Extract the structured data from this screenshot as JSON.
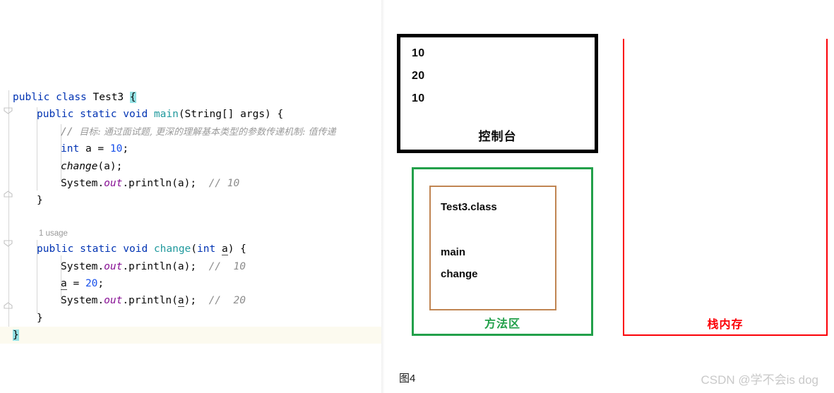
{
  "editor": {
    "usage_hint": "1 usage",
    "lines": [
      {
        "id": "line-class-decl",
        "indent": 0,
        "current": false
      },
      {
        "id": "line-main-sig",
        "indent": 1,
        "current": false
      },
      {
        "id": "line-comment",
        "indent": 2,
        "current": false
      },
      {
        "id": "line-int-a",
        "indent": 2,
        "current": false
      },
      {
        "id": "line-change-call",
        "indent": 2,
        "current": false
      },
      {
        "id": "line-println-main",
        "indent": 2,
        "current": false
      },
      {
        "id": "line-main-close",
        "indent": 1,
        "current": false
      },
      {
        "id": "line-blank",
        "indent": 0,
        "current": false
      },
      {
        "id": "line-change-sig",
        "indent": 1,
        "current": false
      },
      {
        "id": "line-println-1",
        "indent": 2,
        "current": false
      },
      {
        "id": "line-assign-a",
        "indent": 2,
        "current": false
      },
      {
        "id": "line-println-2",
        "indent": 2,
        "current": false
      },
      {
        "id": "line-change-close",
        "indent": 1,
        "current": false
      },
      {
        "id": "line-class-close",
        "indent": 0,
        "current": true
      }
    ],
    "tokens": {
      "kw_public": "public",
      "kw_class": "class",
      "kw_static": "static",
      "kw_void": "void",
      "kw_int": "int",
      "type_name": "Test3",
      "brace_open": "{",
      "brace_close": "}",
      "main_name": "main",
      "main_params": "(String[] args) {",
      "comment_slashes": "//",
      "comment_text": "目标: 通过面试题, 更深的理解基本类型的参数传递机制: 值传递",
      "decl_int_a": "int a = 10;",
      "int_a_value": "10",
      "call_change": "change",
      "call_change_args": "(a);",
      "system": "System.",
      "out": "out",
      "println_open": ".println(",
      "var_a": "a",
      "println_close": ");",
      "comment_10": "// 10",
      "comment_10_wide": "//  10",
      "comment_20_wide": "//  20",
      "change_name": "change",
      "change_params_open": "(",
      "change_param_type": "int",
      "change_param_name": "a",
      "change_params_close": ") {",
      "assign_a": "a = 20;",
      "assign_value": "20"
    }
  },
  "diagram": {
    "console": {
      "label": "控制台",
      "lines": [
        "10",
        "20",
        "10"
      ]
    },
    "method_area": {
      "label": "方法区",
      "class_entry": "Test3.class",
      "methods": [
        "main",
        "change"
      ]
    },
    "stack_memory": {
      "label": "栈内存"
    },
    "colors": {
      "console_border": "#000000",
      "method_area_border": "#22A04A",
      "class_box_border": "#C08552",
      "stack_border": "#FB0007"
    }
  },
  "footer": {
    "figure_caption": "图4",
    "watermark": "CSDN @学不会is dog"
  }
}
